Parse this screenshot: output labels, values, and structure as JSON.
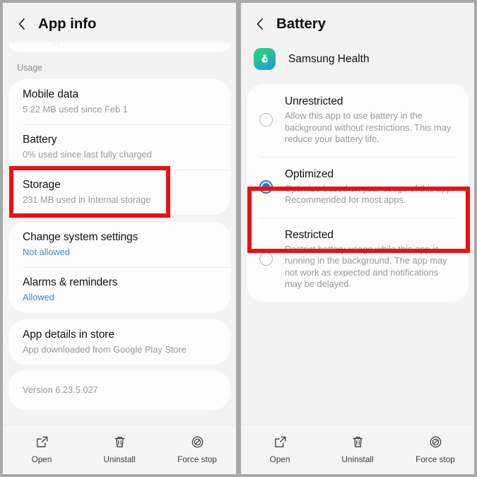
{
  "left_panel": {
    "header": {
      "title": "App info",
      "back_icon": "chevron-left-icon"
    },
    "clipped_card_hint": "..",
    "usage_label": "Usage",
    "usage_rows": [
      {
        "title": "Mobile data",
        "sub": "5.22 MB used since Feb 1"
      },
      {
        "title": "Battery",
        "sub": "0% used since last fully charged"
      },
      {
        "title": "Storage",
        "sub": "231 MB used in Internal storage"
      }
    ],
    "permission_rows": [
      {
        "title": "Change system settings",
        "sub": "Not allowed"
      },
      {
        "title": "Alarms & reminders",
        "sub": "Allowed"
      }
    ],
    "store_row": {
      "title": "App details in store",
      "sub": "App downloaded from Google Play Store"
    },
    "version": "Version 6.23.5.027",
    "bottom_actions": [
      {
        "label": "Open",
        "icon": "open-external-icon"
      },
      {
        "label": "Uninstall",
        "icon": "trash-icon"
      },
      {
        "label": "Force stop",
        "icon": "force-stop-icon"
      }
    ]
  },
  "right_panel": {
    "header": {
      "title": "Battery",
      "back_icon": "chevron-left-icon"
    },
    "app": {
      "name": "Samsung Health",
      "icon": "samsung-health-icon"
    },
    "options": [
      {
        "title": "Unrestricted",
        "desc": "Allow this app to use battery in the background without restrictions. This may reduce your battery life.",
        "selected": false
      },
      {
        "title": "Optimized",
        "desc": "Optimize based on your usage of this app. Recommended for most apps.",
        "selected": true
      },
      {
        "title": "Restricted",
        "desc": "Restrict battery usage while this app is running in the background. The app may not work as expected and notifications may be delayed.",
        "selected": false
      }
    ],
    "bottom_actions": [
      {
        "label": "Open",
        "icon": "open-external-icon"
      },
      {
        "label": "Uninstall",
        "icon": "trash-icon"
      },
      {
        "label": "Force stop",
        "icon": "force-stop-icon"
      }
    ]
  },
  "annotations": {
    "highlight_color": "#e81212",
    "accent_color": "#1a73e8",
    "link_color": "#3b8bd4"
  }
}
